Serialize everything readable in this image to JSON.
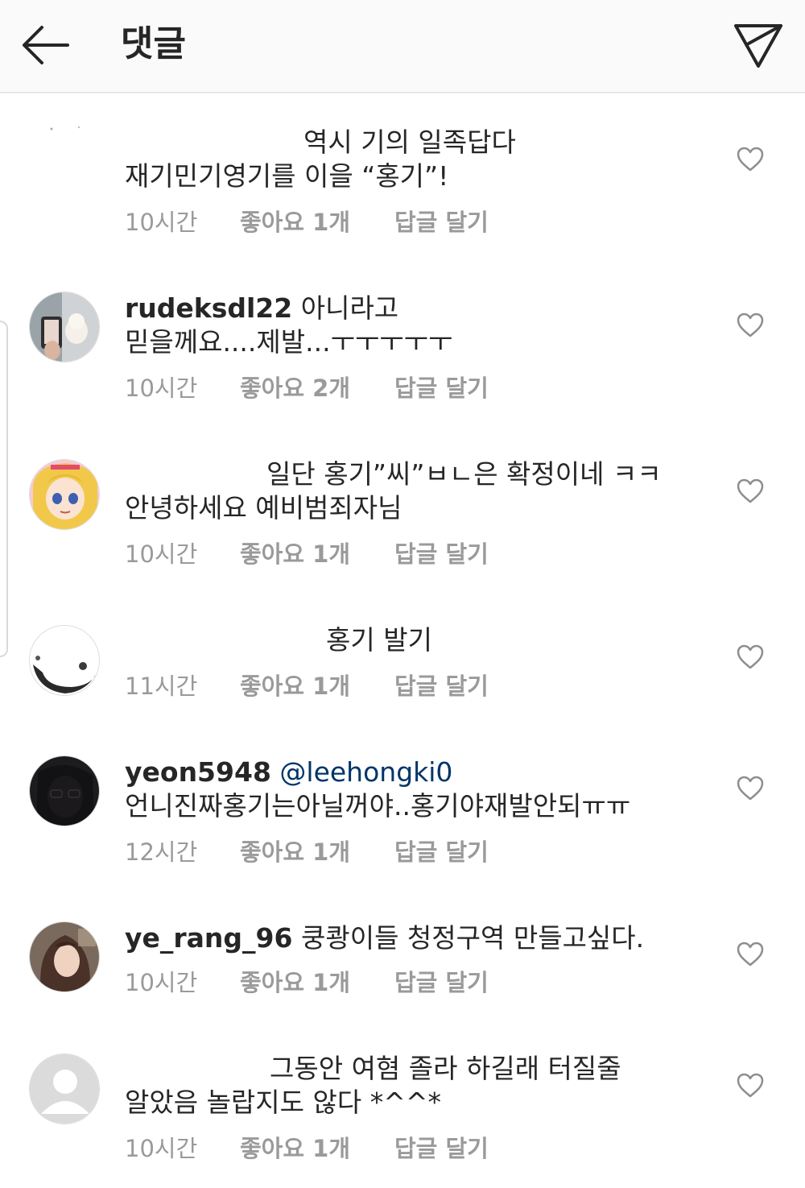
{
  "header": {
    "title": "댓글"
  },
  "icons": {
    "back": "arrow-left-icon",
    "send": "paper-plane-icon",
    "heart": "heart-outline-icon"
  },
  "colors": {
    "text": "#262626",
    "meta": "#9a9a9a",
    "mention": "#003569",
    "header_bg": "#fafafa"
  },
  "comments": [
    {
      "username": "",
      "line1": "역시 기의 일족답다",
      "line2": "재기민기영기를 이을 “홍기”!",
      "time": "10시간",
      "likes": "좋아요 1개",
      "reply": "답글 달기"
    },
    {
      "username": "rudeksdl22",
      "line1": "아니라고",
      "line2": "믿을께요....제발...ㅜㅜㅜㅜㅜ",
      "time": "10시간",
      "likes": "좋아요 2개",
      "reply": "답글 달기"
    },
    {
      "username": "",
      "line1": "일단 홍기”씨”ㅂㄴ은 확정이네 ㅋㅋ",
      "line2": "안녕하세요 예비범죄자님",
      "time": "10시간",
      "likes": "좋아요 1개",
      "reply": "답글 달기"
    },
    {
      "username": "",
      "line1": "홍기 발기",
      "line2": "",
      "time": "11시간",
      "likes": "좋아요 1개",
      "reply": "답글 달기"
    },
    {
      "username": "yeon5948",
      "mention": "@leehongki0",
      "line1": "",
      "line2": "언니진짜홍기는아닐꺼야..홍기야재발안되ㅠㅠ",
      "time": "12시간",
      "likes": "좋아요 1개",
      "reply": "답글 달기"
    },
    {
      "username": "ye_rang_96",
      "line1": "쿵쾅이들 청정구역 만들고싶다.",
      "line2": "",
      "time": "10시간",
      "likes": "좋아요 1개",
      "reply": "답글 달기"
    },
    {
      "username": "",
      "line1": "그동안 여혐 졸라 하길래 터질줄",
      "line2": "알았음 놀랍지도 않다 *^^*",
      "time": "10시간",
      "likes": "좋아요 1개",
      "reply": "답글 달기"
    }
  ]
}
